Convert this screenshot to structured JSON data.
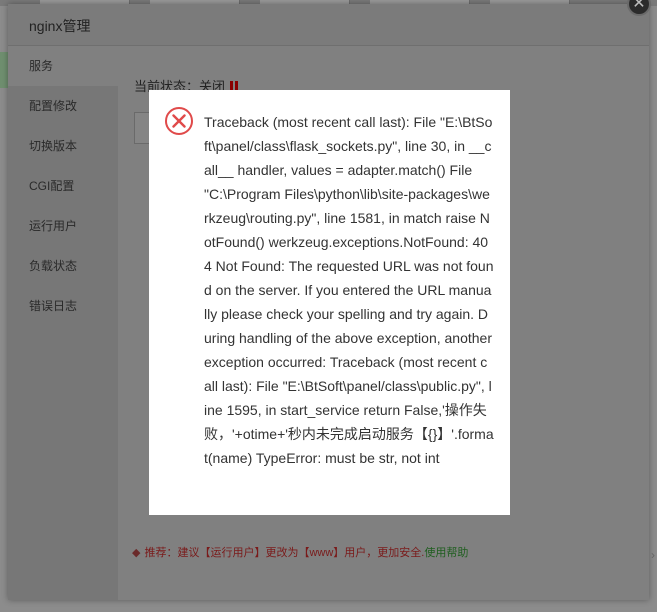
{
  "dialog": {
    "title": "nginx管理",
    "close_icon": "close-icon"
  },
  "menu": {
    "items": [
      {
        "label": "服务"
      },
      {
        "label": "配置修改"
      },
      {
        "label": "切换版本"
      },
      {
        "label": "CGI配置"
      },
      {
        "label": "运行用户"
      },
      {
        "label": "负载状态"
      },
      {
        "label": "错误日志"
      }
    ]
  },
  "status": {
    "label": "当前状态：",
    "value": "关闭"
  },
  "tip": {
    "prefix": "推荐：建议【运行用户】更改为【www】用户，更加安全.",
    "help_link": "使用帮助"
  },
  "error": {
    "icon": "error-circle-icon",
    "message": "Traceback (most recent call last): File \"E:\\BtSoft\\panel/class\\flask_sockets.py\", line 30, in __call__ handler, values = adapter.match() File \"C:\\Program Files\\python\\lib\\site-packages\\werkzeug\\routing.py\", line 1581, in match raise NotFound() werkzeug.exceptions.NotFound: 404 Not Found: The requested URL was not found on the server. If you entered the URL manually please check your spelling and try again. During handling of the above exception, another exception occurred: Traceback (most recent call last): File \"E:\\BtSoft\\panel/class\\public.py\", line 1595, in start_service return False,'操作失败，'+otime+'秒内未完成启动服务【{}】'.format(name) TypeError: must be str, not int"
  },
  "colors": {
    "overlay": "#808080",
    "error_icon": "#e04a4a",
    "status_bar": "#8a0000",
    "help_link": "#1f5e1f"
  }
}
